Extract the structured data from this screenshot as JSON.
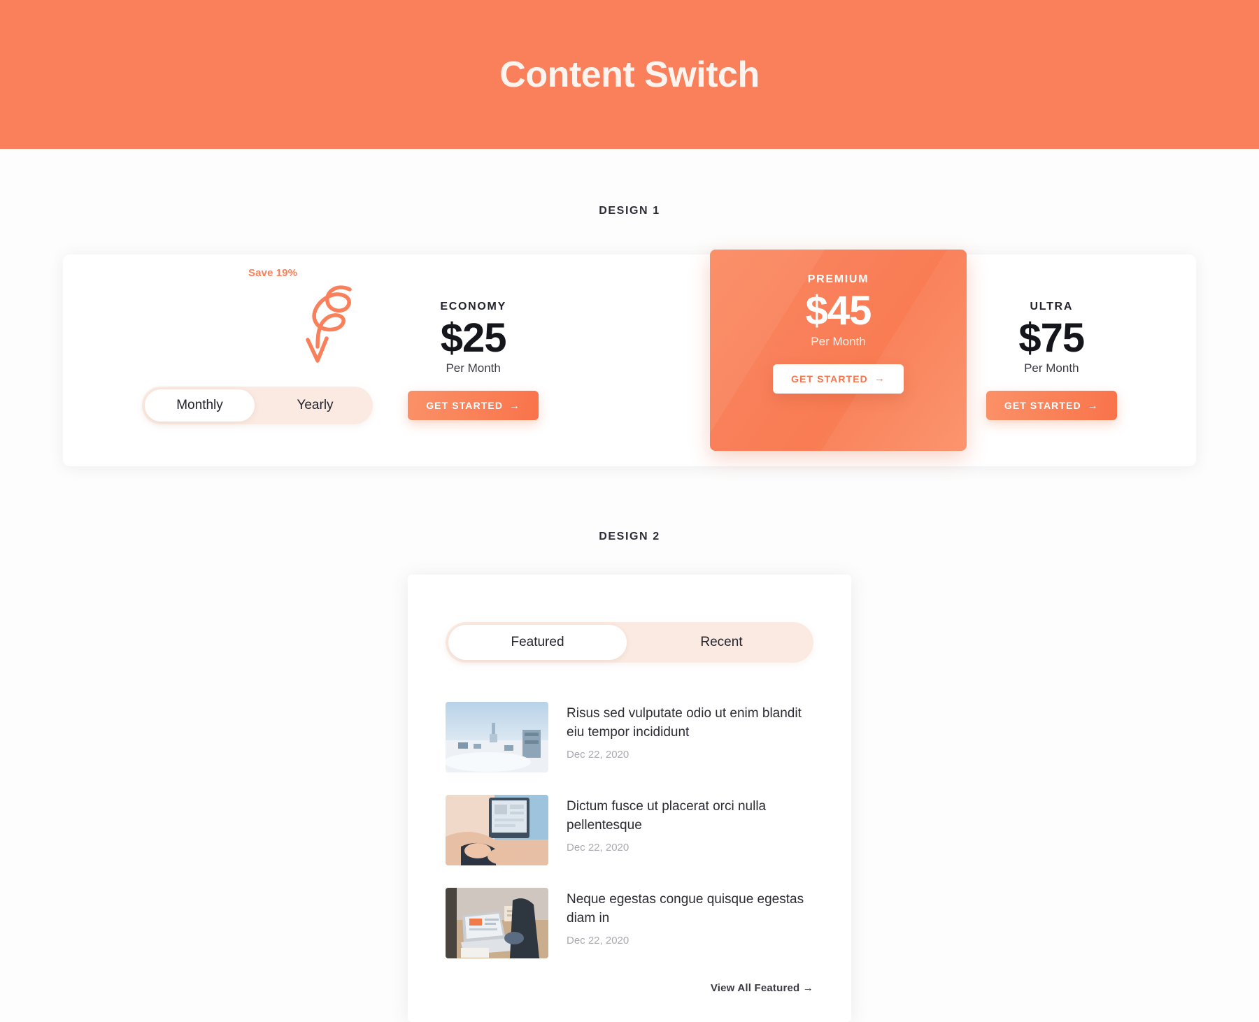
{
  "header": {
    "title": "Content Switch",
    "bg_color": "#f9805a",
    "title_color": "#fdf3ef"
  },
  "theme": {
    "accent": "#f9805a",
    "accent_dark": "#f9734a",
    "pill_track": "#fbeae1",
    "page_bg": "#fdfdfd"
  },
  "design1": {
    "label": "DESIGN 1",
    "save_badge": "Save 19%",
    "doodle_icon": "curly-arrow-icon",
    "toggle": {
      "options": [
        {
          "label": "Monthly",
          "active": true
        },
        {
          "label": "Yearly",
          "active": false
        }
      ]
    },
    "plans": [
      {
        "name": "ECONOMY",
        "price": "$25",
        "period": "Per Month",
        "cta": "GET STARTED",
        "cta_arrow": "→",
        "featured": false
      },
      {
        "name": "PREMIUM",
        "price": "$45",
        "period": "Per Month",
        "cta": "GET STARTED",
        "cta_arrow": "→",
        "featured": true
      },
      {
        "name": "ULTRA",
        "price": "$75",
        "period": "Per Month",
        "cta": "GET STARTED",
        "cta_arrow": "→",
        "featured": false
      }
    ]
  },
  "design2": {
    "label": "DESIGN 2",
    "tabs": [
      {
        "label": "Featured",
        "active": true
      },
      {
        "label": "Recent",
        "active": false
      }
    ],
    "articles": [
      {
        "title": "Risus sed vulputate odio ut enim blandit eiu tempor incididunt",
        "date": "Dec 22, 2020",
        "thumb_name": "snowy-cityscape-thumbnail"
      },
      {
        "title": "Dictum fusce ut placerat orci nulla pellentesque",
        "date": "Dec 22, 2020",
        "thumb_name": "hands-on-laptop-thumbnail"
      },
      {
        "title": "Neque egestas congue quisque egestas diam in",
        "date": "Dec 22, 2020",
        "thumb_name": "desk-workspace-laptop-thumbnail"
      }
    ],
    "view_all": "View All Featured",
    "view_all_arrow": "→"
  }
}
